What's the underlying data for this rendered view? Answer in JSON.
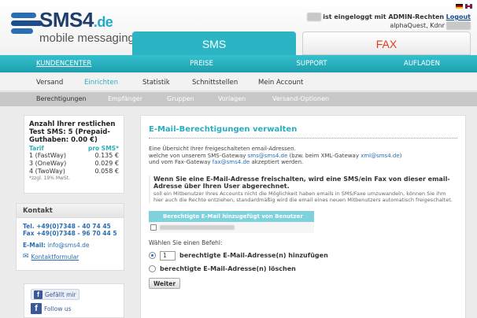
{
  "header": {
    "logo": {
      "brand": "SMS4",
      "domain": ".de",
      "tagline": "mobile messaging"
    },
    "login": {
      "prefix": "ist eingeloggt mit ADMIN-Rechten",
      "logout": "Logout",
      "account_line": "alphaQuest, Kdnr"
    },
    "tabs": {
      "sms": "SMS",
      "fax": "FAX"
    }
  },
  "mainnav": [
    "KUNDENCENTER",
    "PREISE",
    "SUPPORT",
    "AUFLADEN"
  ],
  "subnav": [
    "Versand",
    "Einrichten",
    "Statistik",
    "Schnittstellen",
    "Mein Account"
  ],
  "subsubnav": [
    "Berechtigungen",
    "Empfänger",
    "Gruppen",
    "Vorlagen",
    "Versand-Optionen"
  ],
  "sidebar": {
    "tarif": {
      "heading": "Anzahl Ihrer restlichen Test SMS: 5 (Prepaid-Guthaben: 0.00 €)",
      "col_tarif": "Tarif",
      "col_price": "pro SMS*",
      "rows": [
        {
          "name": "1 (FastWay)",
          "price": "0.135 €"
        },
        {
          "name": "3 (OneWay)",
          "price": "0.029 €"
        },
        {
          "name": "4 (TwoWay)",
          "price": "0.058 €"
        }
      ],
      "note": "*zzgl. 19% MwSt."
    },
    "kontakt": {
      "title": "Kontakt",
      "tel": "Tel. +49(0)7348 - 40 74 45",
      "fax": "Fax +49(0)7348 - 96 70 44 5",
      "email_label": "E-Mail:",
      "email": "info@sms4.de",
      "form_link": "Kontaktformular"
    },
    "social": {
      "like": "Gefällt mir",
      "follow": "Follow us"
    }
  },
  "content": {
    "title": "E-Mail-Berechtigungen verwalten",
    "intro_1": "Eine Übersicht Ihrer freigeschalteten email-Adressen.",
    "intro_2a": "welche von unserem SMS-Gateway",
    "intro_2b": "sms@sms4.de",
    "intro_2c": "(bzw. beim XML-Gateway",
    "intro_2d": "xml@sms4.de",
    "intro_2e": ")",
    "intro_3a": "und vom Fax-Gateway",
    "intro_3b": "fax@sms4.de",
    "intro_3c": "akzeptiert werden.",
    "notice_title": "Wenn Sie eine E-Mail-Adresse freischalten, wird eine SMS/ein Fax von dieser email-Adresse über Ihren User abgerechnet.",
    "notice_text": "soll ein Mitbenutzer Ihres Accounts nicht die Möglichkeit haben emails in SMS/Faxe umzuwandeln, können Sie ihm hier auch die Rechte entziehen, standardmäßig wird die email eines neuen Mitbenutzers automatisch freigeschaltet.",
    "table_header": "Berechtigte E-Mail   hinzugefügt von Benutzer",
    "command_label": "Wählen Sie einen Befehl:",
    "option_add_value": "1",
    "option_add": "berechtigte E-Mail-Adresse(n) hinzufügen",
    "option_delete": "berechtigte E-Mail-Adresse(n) löschen",
    "submit": "Weiter"
  },
  "colors": {
    "accent": "#2aaebf",
    "fax": "#e03c1e",
    "brand": "#1f3f6b"
  }
}
